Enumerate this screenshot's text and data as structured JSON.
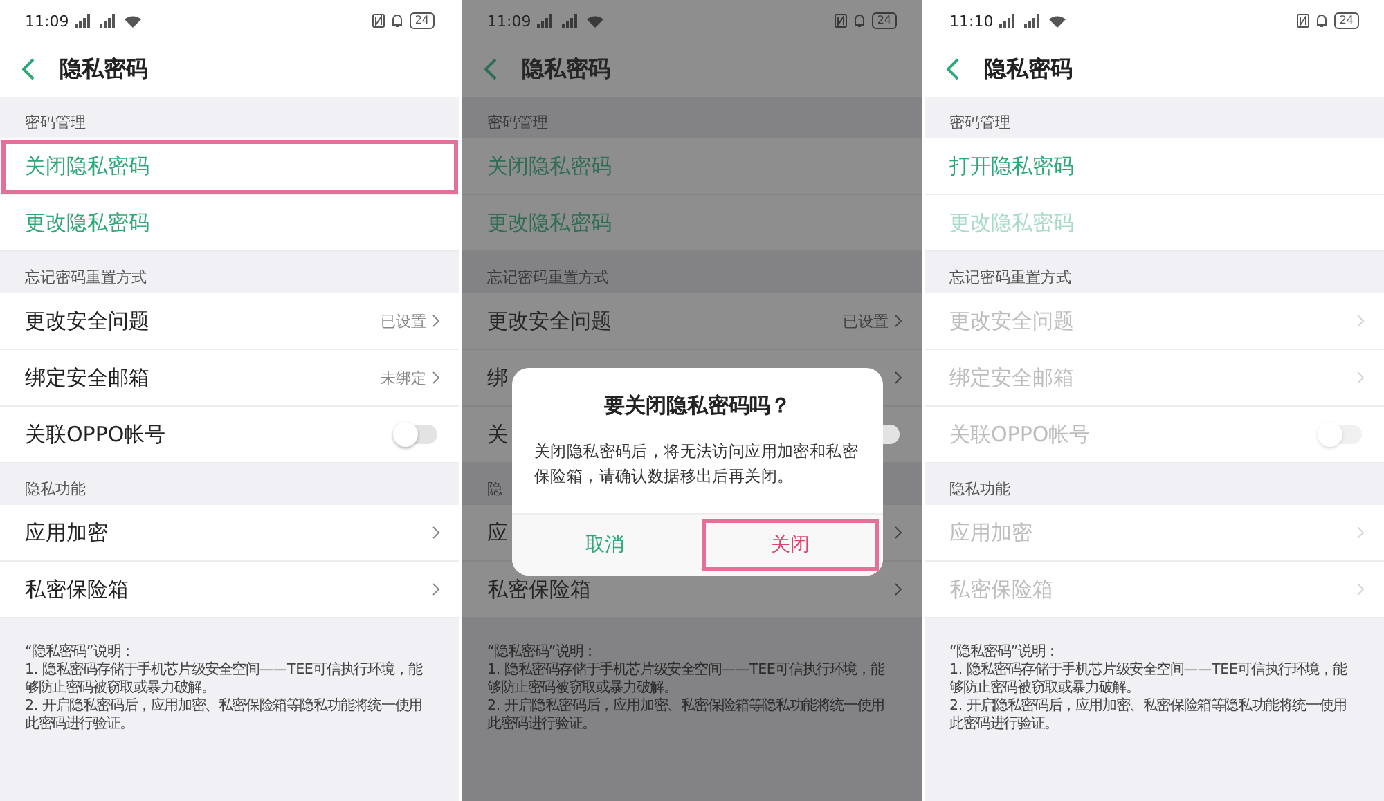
{
  "screens": [
    {
      "dimmed": false,
      "status_bar": {
        "time": "11:09",
        "battery": "24"
      },
      "title": "隐私密码",
      "sections": [
        {
          "header": "密码管理",
          "rows": [
            {
              "kind": "action",
              "label": "关闭隐私密码",
              "disabled": false,
              "highlighted": true
            },
            {
              "kind": "action",
              "label": "更改隐私密码",
              "disabled": false,
              "highlighted": false
            }
          ]
        },
        {
          "header": "忘记密码重置方式",
          "rows": [
            {
              "kind": "link",
              "label": "更改安全问题",
              "value": "已设置",
              "disabled": false,
              "highlighted": false
            },
            {
              "kind": "link",
              "label": "绑定安全邮箱",
              "value": "未绑定",
              "disabled": false,
              "highlighted": false
            },
            {
              "kind": "toggle",
              "label": "关联OPPO帐号",
              "on": false,
              "disabled": false,
              "highlighted": false
            }
          ]
        },
        {
          "header": "隐私功能",
          "rows": [
            {
              "kind": "link",
              "label": "应用加密",
              "disabled": false,
              "highlighted": false
            },
            {
              "kind": "link",
              "label": "私密保险箱",
              "disabled": false,
              "highlighted": false
            }
          ]
        }
      ],
      "note": [
        "“隐私密码”说明：",
        "1. 隐私密码存储于手机芯片级安全空间——TEE可信执行环境，能够防止密码被窃取或暴力破解。",
        "2. 开启隐私密码后，应用加密、私密保险箱等隐私功能将统一使用此密码进行验证。"
      ]
    },
    {
      "dimmed": true,
      "status_bar": {
        "time": "11:09",
        "battery": "24"
      },
      "title": "隐私密码",
      "sections": [
        {
          "header": "密码管理",
          "rows": [
            {
              "kind": "action",
              "label": "关闭隐私密码",
              "disabled": false,
              "highlighted": false
            },
            {
              "kind": "action",
              "label": "更改隐私密码",
              "disabled": false,
              "highlighted": false
            }
          ]
        },
        {
          "header": "忘记密码重置方式",
          "rows": [
            {
              "kind": "link",
              "label": "更改安全问题",
              "value": "已设置",
              "disabled": false,
              "highlighted": false
            },
            {
              "kind": "link",
              "label": "绑",
              "disabled": false,
              "highlighted": false
            },
            {
              "kind": "toggle",
              "label": "关",
              "on": false,
              "disabled": false,
              "highlighted": false
            }
          ]
        },
        {
          "header": "隐",
          "rows": [
            {
              "kind": "link",
              "label": "应",
              "disabled": false,
              "highlighted": false
            },
            {
              "kind": "link",
              "label": "私密保险箱",
              "disabled": false,
              "highlighted": false
            }
          ]
        }
      ],
      "note": [
        "“隐私密码”说明：",
        "1. 隐私密码存储于手机芯片级安全空间——TEE可信执行环境，能够防止密码被窃取或暴力破解。",
        "2. 开启隐私密码后，应用加密、私密保险箱等隐私功能将统一使用此密码进行验证。"
      ],
      "dialog": {
        "title": "要关闭隐私密码吗？",
        "message": "关闭隐私密码后，将无法访问应用加密和私密保险箱，请确认数据移出后再关闭。",
        "buttons": [
          {
            "kind": "cancel",
            "label": "取消",
            "highlighted": false
          },
          {
            "kind": "confirm",
            "label": "关闭",
            "highlighted": true
          }
        ]
      }
    },
    {
      "dimmed": false,
      "status_bar": {
        "time": "11:10",
        "battery": "24"
      },
      "title": "隐私密码",
      "sections": [
        {
          "header": "密码管理",
          "rows": [
            {
              "kind": "action",
              "label": "打开隐私密码",
              "disabled": false,
              "highlighted": false
            },
            {
              "kind": "action",
              "label": "更改隐私密码",
              "disabled": true,
              "highlighted": false
            }
          ]
        },
        {
          "header": "忘记密码重置方式",
          "rows": [
            {
              "kind": "link",
              "label": "更改安全问题",
              "disabled": true,
              "highlighted": false
            },
            {
              "kind": "link",
              "label": "绑定安全邮箱",
              "disabled": true,
              "highlighted": false
            },
            {
              "kind": "toggle",
              "label": "关联OPPO帐号",
              "on": false,
              "disabled": true,
              "highlighted": false
            }
          ]
        },
        {
          "header": "隐私功能",
          "rows": [
            {
              "kind": "link",
              "label": "应用加密",
              "disabled": true,
              "highlighted": false
            },
            {
              "kind": "link",
              "label": "私密保险箱",
              "disabled": true,
              "highlighted": false
            }
          ]
        }
      ],
      "note": [
        "“隐私密码”说明：",
        "1. 隐私密码存储于手机芯片级安全空间——TEE可信执行环境，能够防止密码被窃取或暴力破解。",
        "2. 开启隐私密码后，应用加密、私密保险箱等隐私功能将统一使用此密码进行验证。"
      ]
    }
  ]
}
